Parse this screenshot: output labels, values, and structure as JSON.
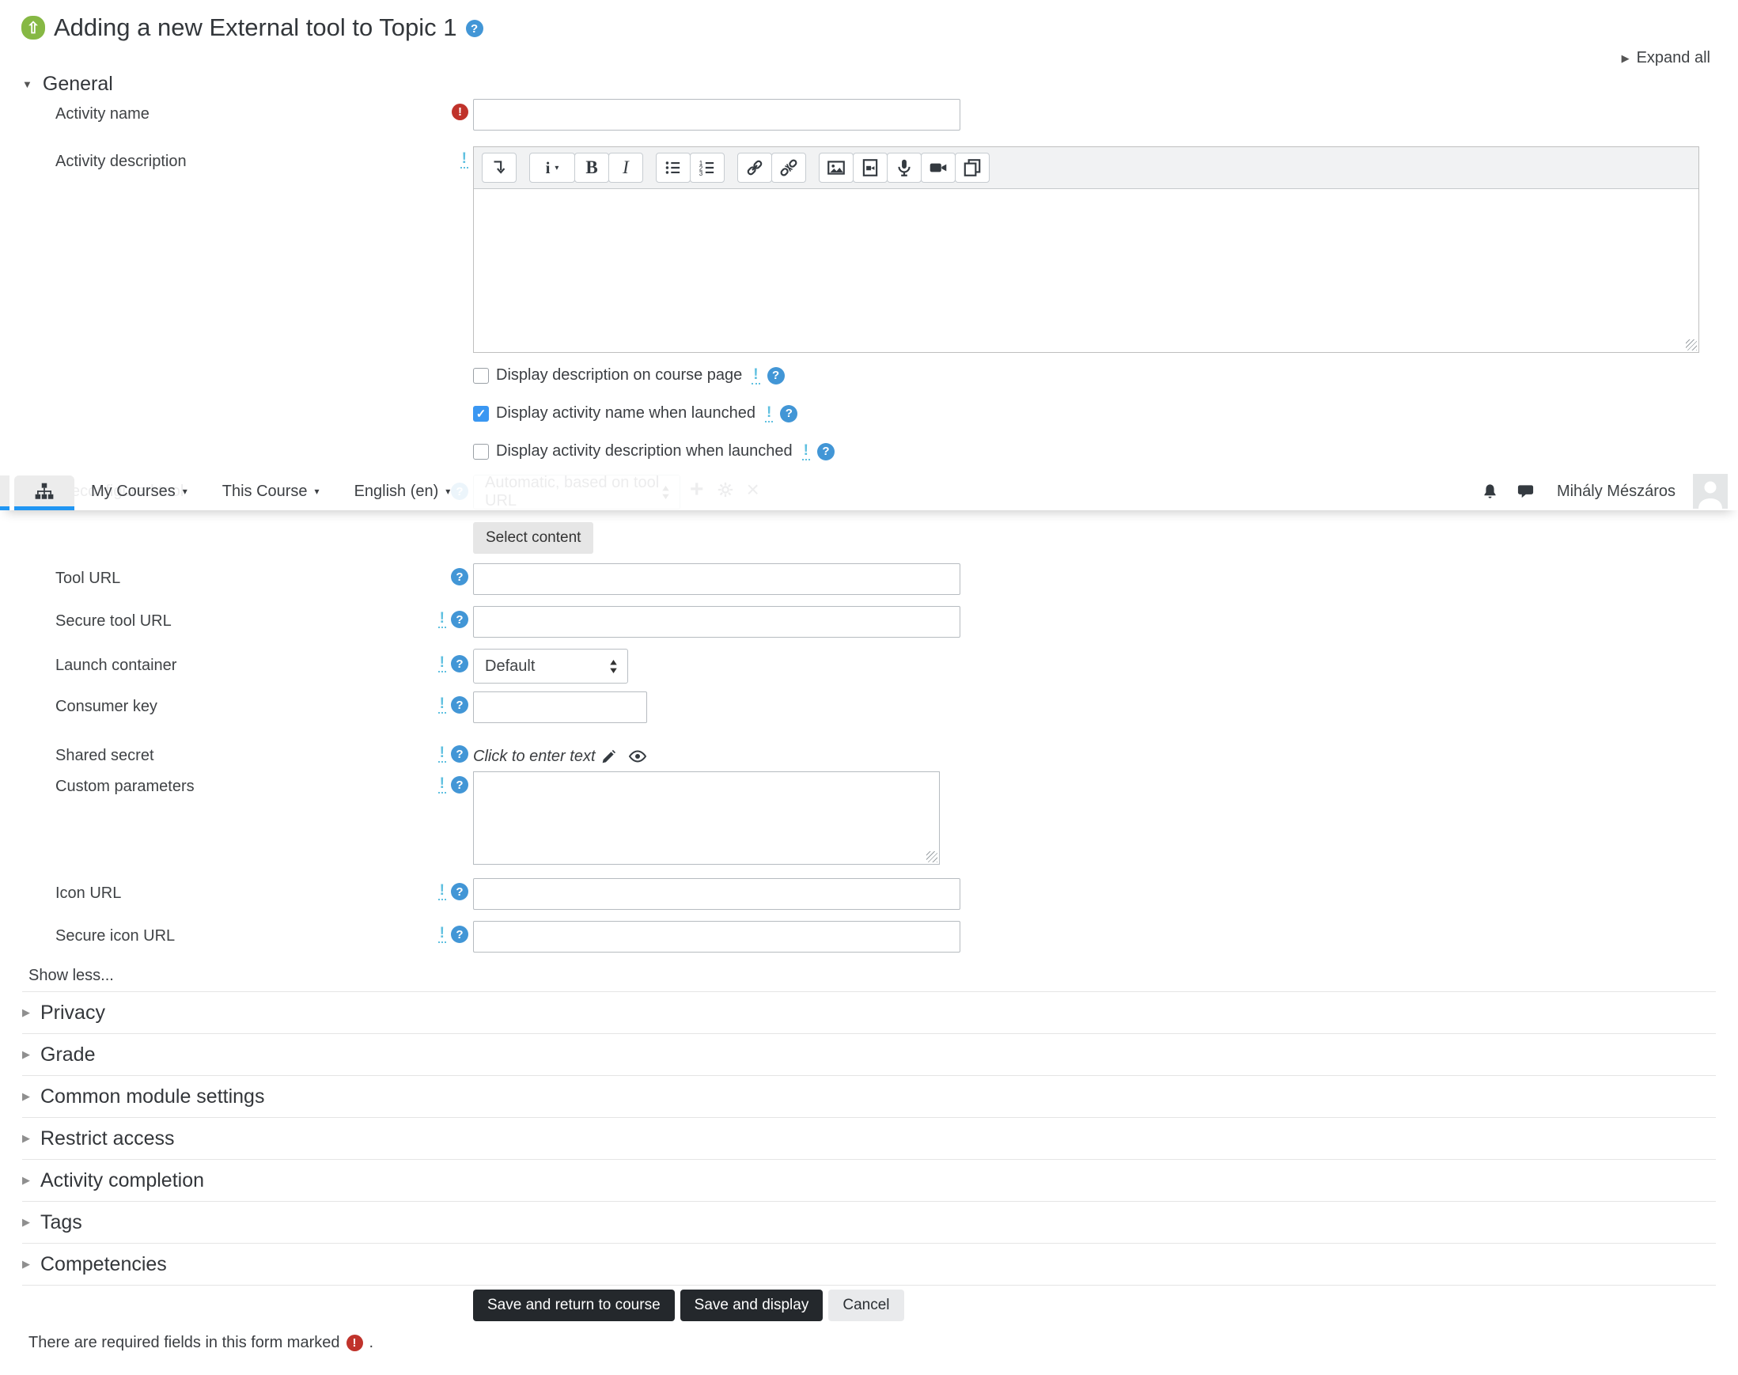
{
  "header": {
    "title": "Adding a new External tool to Topic 1",
    "expand_all": "Expand all"
  },
  "navbar": {
    "items": [
      "My Courses",
      "This Course",
      "English (en)"
    ],
    "user_name": "Mihály Mészáros",
    "icons": [
      "sitemap-icon",
      "notifications-bell-icon",
      "messages-chat-icon",
      "user-avatar"
    ]
  },
  "general": {
    "heading": "General",
    "activity_name_label": "Activity name",
    "activity_description_label": "Activity description",
    "editor_toolbar_icons": [
      "collapse-toolbar",
      "paragraph-style",
      "bold",
      "italic",
      "unordered-list",
      "ordered-list",
      "insert-link",
      "unlink",
      "insert-image",
      "insert-media",
      "record-audio",
      "record-video",
      "manage-files"
    ],
    "checkboxes": [
      {
        "label": "Display description on course page",
        "checked": false
      },
      {
        "label": "Display activity name when launched",
        "checked": true
      },
      {
        "label": "Display activity description when launched",
        "checked": false
      }
    ]
  },
  "preconfigured": {
    "label": "Preconfigured tool",
    "select_value": "Automatic, based on tool URL",
    "icons": [
      "add-tool-plus-icon",
      "edit-tool-gear-icon",
      "delete-tool-x-icon"
    ]
  },
  "tool_settings": {
    "select_content_button": "Select content",
    "tool_url_label": "Tool URL",
    "secure_tool_url_label": "Secure tool URL",
    "launch_container_label": "Launch container",
    "launch_container_value": "Default",
    "consumer_key_label": "Consumer key",
    "shared_secret_label": "Shared secret",
    "shared_secret_text": "Click to enter text",
    "custom_parameters_label": "Custom parameters",
    "icon_url_label": "Icon URL",
    "secure_icon_url_label": "Secure icon URL",
    "show_less": "Show less..."
  },
  "sections": [
    "Privacy",
    "Grade",
    "Common module settings",
    "Restrict access",
    "Activity completion",
    "Tags",
    "Competencies"
  ],
  "actions": {
    "save_return": "Save and return to course",
    "save_display": "Save and display",
    "cancel": "Cancel"
  },
  "footer": {
    "required_note": "There are required fields in this form marked",
    "period": "."
  },
  "colors": {
    "accent_blue": "#2196f3",
    "help_blue": "#4296d6",
    "advanced_cyan": "#5fc0e0",
    "required_red": "#c0332b",
    "tool_green": "#86b844",
    "dark_button": "#24282c"
  }
}
